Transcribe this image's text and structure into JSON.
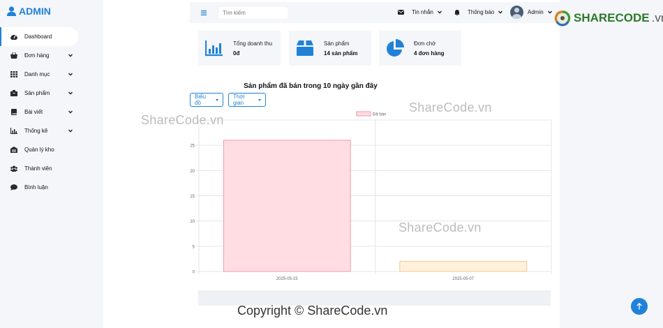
{
  "sidebar": {
    "brand": "ADMIN",
    "items": [
      {
        "label": "Dashboard",
        "icon": "gauge-icon",
        "active": true,
        "has_sub": false
      },
      {
        "label": "Đơn hàng",
        "icon": "basket-icon",
        "active": false,
        "has_sub": true
      },
      {
        "label": "Danh mục",
        "icon": "grid-icon",
        "active": false,
        "has_sub": true
      },
      {
        "label": "Sản phẩm",
        "icon": "box-icon",
        "active": false,
        "has_sub": true
      },
      {
        "label": "Bài viết",
        "icon": "book-icon",
        "active": false,
        "has_sub": true
      },
      {
        "label": "Thống kê",
        "icon": "chart-icon",
        "active": false,
        "has_sub": true
      },
      {
        "label": "Quản lý kho",
        "icon": "warehouse-icon",
        "active": false,
        "has_sub": false
      },
      {
        "label": "Thành viên",
        "icon": "users-icon",
        "active": false,
        "has_sub": false
      },
      {
        "label": "Bình luận",
        "icon": "comment-icon",
        "active": false,
        "has_sub": false
      }
    ]
  },
  "topbar": {
    "search_placeholder": "Tìm kiếm",
    "messages": "Tin nhắn",
    "notifications": "Thông báo",
    "user": "Admin"
  },
  "cards": [
    {
      "title": "Tổng doanh thu",
      "value": "0đ",
      "icon": "bar-chart-icon"
    },
    {
      "title": "Sản phẩm",
      "value": "14 sản phẩm",
      "icon": "package-icon"
    },
    {
      "title": "Đơn chờ",
      "value": "4 đơn hàng",
      "icon": "pie-chart-icon"
    }
  ],
  "filters": {
    "chart_type": "Biểu đồ",
    "time": "Thời gian"
  },
  "watermarks": {
    "site": "ShareCode.vn",
    "copyright": "Copyright © ShareCode.vn",
    "logo_main": "SHARECODE",
    "logo_suffix": ".vn"
  },
  "colors": {
    "accent": "#1f82d8",
    "bar1_fill": "#ffdde3",
    "bar1_stroke": "#f29aaa",
    "bar2_fill": "#fff0dc",
    "bar2_stroke": "#f5c58a"
  },
  "chart_data": {
    "type": "bar",
    "title": "Sản phẩm đã bán trong 10 ngày gần đây",
    "categories": [
      "2025-05-15",
      "2025-05-07"
    ],
    "series": [
      {
        "name": "Đã bán",
        "values": [
          26,
          2
        ]
      }
    ],
    "ylim": [
      0,
      30
    ],
    "yticks": [
      0,
      5,
      10,
      15,
      20,
      25
    ],
    "legend": "top-center",
    "grid": true
  }
}
